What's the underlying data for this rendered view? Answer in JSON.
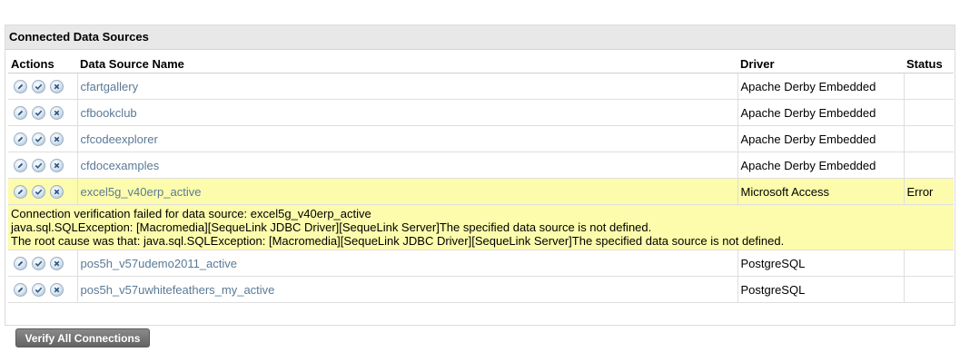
{
  "panel": {
    "title": "Connected Data Sources"
  },
  "table": {
    "headers": {
      "actions": "Actions",
      "name": "Data Source Name",
      "driver": "Driver",
      "status": "Status"
    },
    "rows": [
      {
        "name": "cfartgallery",
        "driver": "Apache Derby Embedded",
        "status": ""
      },
      {
        "name": "cfbookclub",
        "driver": "Apache Derby Embedded",
        "status": ""
      },
      {
        "name": "cfcodeexplorer",
        "driver": "Apache Derby Embedded",
        "status": ""
      },
      {
        "name": "cfdocexamples",
        "driver": "Apache Derby Embedded",
        "status": ""
      },
      {
        "name": "excel5g_v40erp_active",
        "driver": "Microsoft Access",
        "status": "Error"
      },
      {
        "name": "pos5h_v57udemo2011_active",
        "driver": "PostgreSQL",
        "status": ""
      },
      {
        "name": "pos5h_v57uwhitefeathers_my_active",
        "driver": "PostgreSQL",
        "status": ""
      }
    ],
    "error_message": {
      "line1": "Connection verification failed for data source: excel5g_v40erp_active",
      "line2": "java.sql.SQLException: [Macromedia][SequeLink JDBC Driver][SequeLink Server]The specified data source is not defined.",
      "line3": "The root cause was that: java.sql.SQLException: [Macromedia][SequeLink JDBC Driver][SequeLink Server]The specified data source is not defined."
    }
  },
  "actions": {
    "icons": [
      "pencil-icon",
      "check-icon",
      "close-icon"
    ]
  },
  "verify_button": {
    "label": "Verify All Connections"
  },
  "colors": {
    "error_highlight": "#fcfcac",
    "link": "#5a7a96",
    "header_bg": "#e8e8e8"
  }
}
